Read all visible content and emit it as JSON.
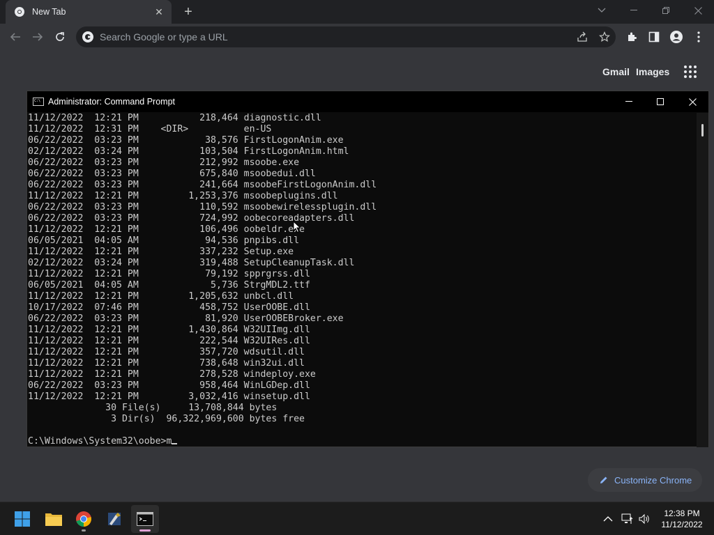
{
  "browser": {
    "tab_title": "New Tab",
    "omnibox_placeholder": "Search Google or type a URL",
    "links": {
      "gmail": "Gmail",
      "images": "Images"
    },
    "customize_label": "Customize Chrome"
  },
  "cmd": {
    "title": "Administrator: Command Prompt",
    "lines": [
      "11/12/2022  12:21 PM           218,464 diagnostic.dll",
      "11/12/2022  12:31 PM    <DIR>          en-US",
      "06/22/2022  03:23 PM            38,576 FirstLogonAnim.exe",
      "02/12/2022  03:24 PM           103,504 FirstLogonAnim.html",
      "06/22/2022  03:23 PM           212,992 msoobe.exe",
      "06/22/2022  03:23 PM           675,840 msoobedui.dll",
      "06/22/2022  03:23 PM           241,664 msoobeFirstLogonAnim.dll",
      "11/12/2022  12:21 PM         1,253,376 msoobeplugins.dll",
      "06/22/2022  03:23 PM           110,592 msoobewirelessplugin.dll",
      "06/22/2022  03:23 PM           724,992 oobecoreadapters.dll",
      "11/12/2022  12:21 PM           106,496 oobeldr.exe",
      "06/05/2021  04:05 AM            94,536 pnpibs.dll",
      "11/12/2022  12:21 PM           337,232 Setup.exe",
      "02/12/2022  03:24 PM           319,488 SetupCleanupTask.dll",
      "11/12/2022  12:21 PM            79,192 spprgrss.dll",
      "06/05/2021  04:05 AM             5,736 StrgMDL2.ttf",
      "11/12/2022  12:21 PM         1,205,632 unbcl.dll",
      "10/17/2022  07:46 PM           458,752 UserOOBE.dll",
      "06/22/2022  03:23 PM            81,920 UserOOBEBroker.exe",
      "11/12/2022  12:21 PM         1,430,864 W32UIImg.dll",
      "11/12/2022  12:21 PM           222,544 W32UIRes.dll",
      "11/12/2022  12:21 PM           357,720 wdsutil.dll",
      "11/12/2022  12:21 PM           738,648 win32ui.dll",
      "11/12/2022  12:21 PM           278,528 windeploy.exe",
      "06/22/2022  03:23 PM           958,464 WinLGDep.dll",
      "11/12/2022  12:21 PM         3,032,416 winsetup.dll",
      "              30 File(s)     13,708,844 bytes",
      "               3 Dir(s)  96,322,969,600 bytes free",
      ""
    ],
    "prompt": "C:\\Windows\\System32\\oobe>m"
  },
  "taskbar": {
    "time": "12:38 PM",
    "date": "11/12/2022"
  },
  "colors": {
    "accent_blue": "#8ab4f8",
    "terminal_text": "#cccccc",
    "terminal_bg": "#0c0c0c"
  }
}
